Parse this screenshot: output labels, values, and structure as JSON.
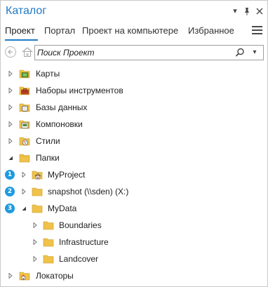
{
  "window": {
    "title": "Каталог",
    "controls": [
      "chevron-down-icon",
      "pin-icon",
      "close-icon"
    ]
  },
  "tabs": [
    {
      "label": "Проект",
      "active": true
    },
    {
      "label": "Портал",
      "active": false
    },
    {
      "label": "Проект на компьютере",
      "active": false
    },
    {
      "label": "Избранное",
      "active": false
    }
  ],
  "search": {
    "placeholder": "Поиск Проект",
    "value": ""
  },
  "tree": [
    {
      "label": "Карты",
      "icon": "maps-folder-icon",
      "expanded": false,
      "level": 0
    },
    {
      "label": "Наборы инструментов",
      "icon": "toolboxes-folder-icon",
      "expanded": false,
      "level": 0
    },
    {
      "label": "Базы данных",
      "icon": "databases-folder-icon",
      "expanded": false,
      "level": 0
    },
    {
      "label": "Компоновки",
      "icon": "layouts-folder-icon",
      "expanded": false,
      "level": 0
    },
    {
      "label": "Стили",
      "icon": "styles-folder-icon",
      "expanded": false,
      "level": 0
    },
    {
      "label": "Папки",
      "icon": "folders-icon",
      "expanded": true,
      "level": 0
    },
    {
      "label": "MyProject",
      "icon": "home-folder-icon",
      "expanded": false,
      "level": 1,
      "badge": "1"
    },
    {
      "label": "snapshot (\\\\sden) (X:)",
      "icon": "folder-icon",
      "expanded": false,
      "level": 1,
      "badge": "2"
    },
    {
      "label": "MyData",
      "icon": "folder-icon",
      "expanded": true,
      "level": 1,
      "badge": "3"
    },
    {
      "label": "Boundaries",
      "icon": "folder-icon",
      "expanded": false,
      "level": 2
    },
    {
      "label": "Infrastructure",
      "icon": "folder-icon",
      "expanded": false,
      "level": 2
    },
    {
      "label": "Landcover",
      "icon": "folder-icon",
      "expanded": false,
      "level": 2
    },
    {
      "label": "Локаторы",
      "icon": "locators-folder-icon",
      "expanded": false,
      "level": 0
    }
  ],
  "colors": {
    "accent": "#2079c7",
    "badge": "#1e9be0",
    "folder": "#f0c24a",
    "folder_dark": "#d9a92a"
  }
}
